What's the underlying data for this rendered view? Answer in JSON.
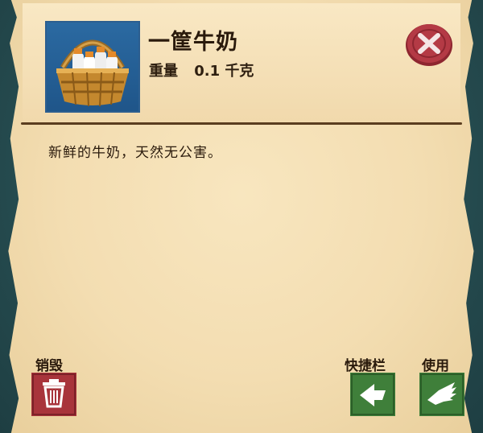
{
  "item": {
    "name": "一筐牛奶",
    "weight_label": "重量",
    "weight_value": "0.1 千克",
    "description": "新鲜的牛奶，天然无公害。",
    "icon": "milk-basket-icon"
  },
  "actions": {
    "destroy_label": "销毁",
    "hotbar_label": "快捷栏",
    "use_label": "使用"
  },
  "colors": {
    "destroy_button": "#a8343b",
    "action_button": "#3f7f3a",
    "close_button": "#b43a45",
    "icon_background": "#2160a0"
  }
}
